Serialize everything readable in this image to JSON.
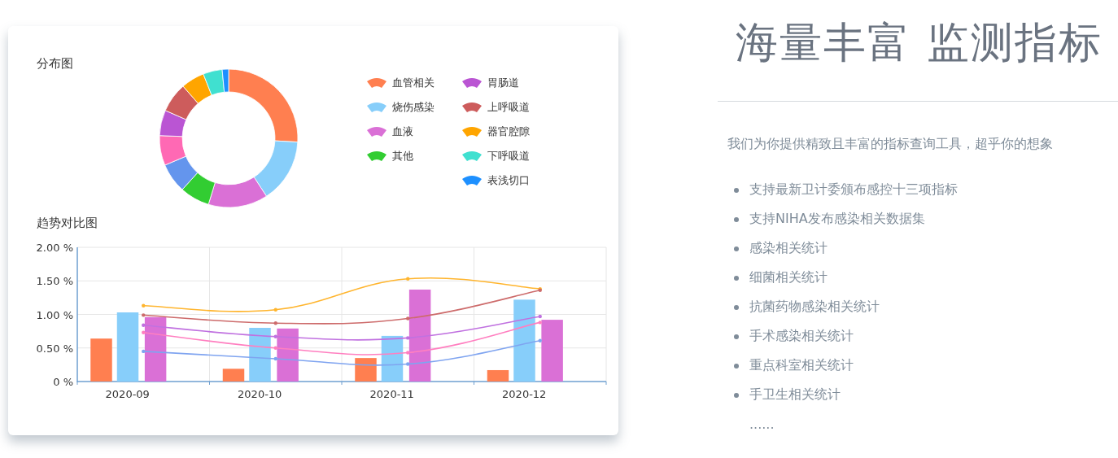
{
  "card": {
    "distribution": {
      "title": "分布图",
      "legend": [
        {
          "label": "血管相关",
          "color": "#ff7f50"
        },
        {
          "label": "胃肠道",
          "color": "#ba55d3"
        },
        {
          "label": "烧伤感染",
          "color": "#87cefa"
        },
        {
          "label": "上呼吸道",
          "color": "#cd5c5c"
        },
        {
          "label": "血液",
          "color": "#da70d6"
        },
        {
          "label": "器官腔隙",
          "color": "#ffa500"
        },
        {
          "label": "其他",
          "color": "#32cd32"
        },
        {
          "label": "下呼吸道",
          "color": "#40e0d0"
        },
        {
          "label": "表浅切口",
          "color": "#1e90ff"
        }
      ]
    },
    "trend": {
      "title": "趋势对比图",
      "chart_data": {
        "type": "bar",
        "categories": [
          "2020-09",
          "2020-10",
          "2020-11",
          "2020-12"
        ],
        "ylim": [
          0,
          2
        ],
        "grid": true,
        "yticks": [
          {
            "value": 0,
            "label": "0 %"
          },
          {
            "value": 0.5,
            "label": "0.50 %"
          },
          {
            "value": 1,
            "label": "1.00 %"
          },
          {
            "value": 1.5,
            "label": "1.50 %"
          },
          {
            "value": 2,
            "label": "2.00 %"
          }
        ],
        "series": [
          {
            "color": "#ff7f50",
            "values": [
              0.64,
              0.19,
              0.35,
              0.17
            ]
          },
          {
            "color": "#87cefa",
            "values": [
              1.03,
              0.8,
              0.68,
              1.22
            ]
          },
          {
            "color": "#da70d6",
            "values": [
              0.96,
              0.79,
              1.37,
              0.92
            ]
          },
          {
            "type": "line",
            "color": "#ffb52e",
            "values": [
              1.13,
              1.07,
              1.53,
              1.38
            ]
          },
          {
            "type": "line",
            "color": "#cd6b6b",
            "values": [
              0.99,
              0.87,
              0.94,
              1.36
            ]
          },
          {
            "type": "line",
            "color": "#c071e0",
            "values": [
              0.84,
              0.67,
              0.65,
              0.97
            ]
          },
          {
            "type": "line",
            "color": "#ff7fc0",
            "values": [
              0.73,
              0.5,
              0.43,
              0.88
            ]
          },
          {
            "type": "line",
            "color": "#7fa4f0",
            "values": [
              0.45,
              0.34,
              0.26,
              0.61
            ]
          }
        ]
      }
    }
  },
  "panel": {
    "heading": "海量丰富 监测指标",
    "intro": "我们为你提供精致且丰富的指标查询工具，超乎你的想象",
    "features": [
      "支持最新卫计委颁布感控十三项指标",
      "支持NIHA发布感染相关数据集",
      "感染相关统计",
      "细菌相关统计",
      "抗菌药物感染相关统计",
      "手术感染相关统计",
      "重点科室相关统计",
      "手卫生相关统计"
    ],
    "more": "......"
  }
}
